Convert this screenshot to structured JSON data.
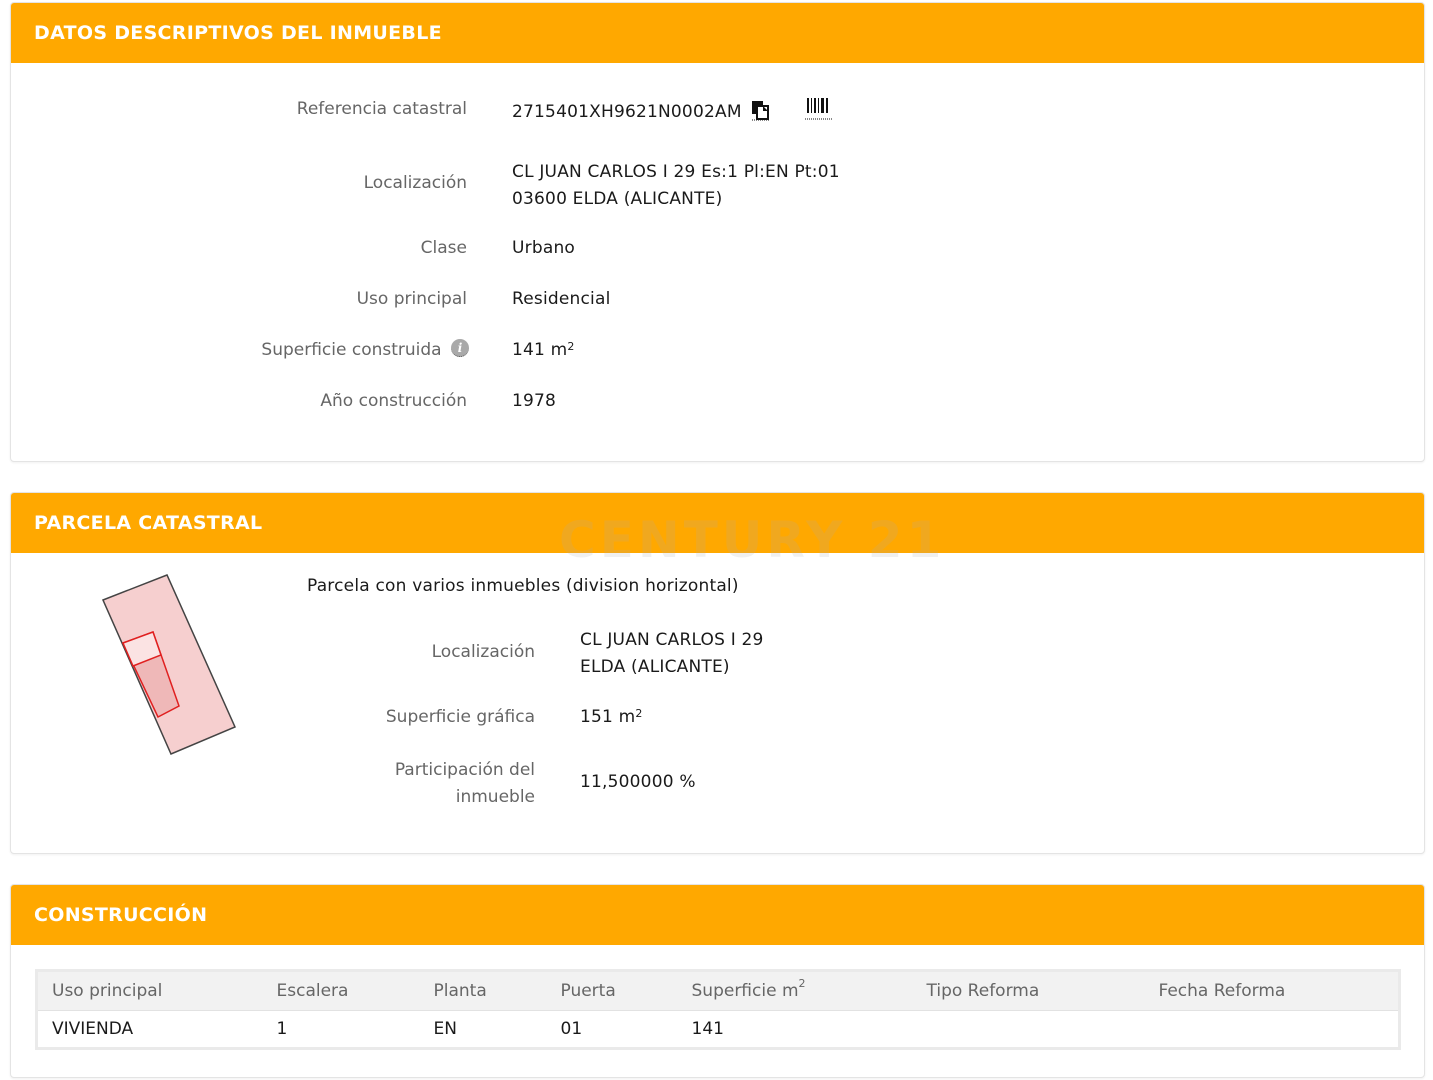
{
  "section1": {
    "title": "DATOS DESCRIPTIVOS DEL INMUEBLE",
    "referencia": {
      "label": "Referencia catastral",
      "value": "2715401XH9621N0002AM",
      "copy_icon": "copy-icon",
      "barcode_icon": "barcode-icon"
    },
    "localizacion": {
      "label": "Localización",
      "line1": "CL JUAN CARLOS I 29 Es:1 Pl:EN Pt:01",
      "line2": "03600 ELDA (ALICANTE)"
    },
    "clase": {
      "label": "Clase",
      "value": "Urbano"
    },
    "uso": {
      "label": "Uso principal",
      "value": "Residencial"
    },
    "superficie": {
      "label": "Superficie construida",
      "value": "141 m",
      "unit_exp": "2",
      "info_icon": "info-icon"
    },
    "anio": {
      "label": "Año construcción",
      "value": "1978"
    }
  },
  "section2": {
    "title": "PARCELA CATASTRAL",
    "watermark": "CENTURY 21",
    "note": "Parcela con varios inmuebles (division horizontal)",
    "localizacion": {
      "label": "Localización",
      "line1": "CL JUAN CARLOS I 29",
      "line2": "ELDA (ALICANTE)"
    },
    "superficie": {
      "label": "Superficie gráfica",
      "value": "151 m",
      "unit_exp": "2"
    },
    "participacion": {
      "label_line1": "Participación del",
      "label_line2": "inmueble",
      "value": "11,500000 %"
    }
  },
  "section3": {
    "title": "CONSTRUCCIÓN",
    "headers": [
      "Uso principal",
      "Escalera",
      "Planta",
      "Puerta",
      "Superficie m",
      "Tipo Reforma",
      "Fecha Reforma"
    ],
    "header_exp": "2",
    "rows": [
      [
        "VIVIENDA",
        "1",
        "EN",
        "01",
        "141",
        "",
        ""
      ]
    ]
  },
  "colors": {
    "header": "#FFA800",
    "parcel_fill": "#F6CFCF",
    "parcel_stroke": "#E02020"
  }
}
